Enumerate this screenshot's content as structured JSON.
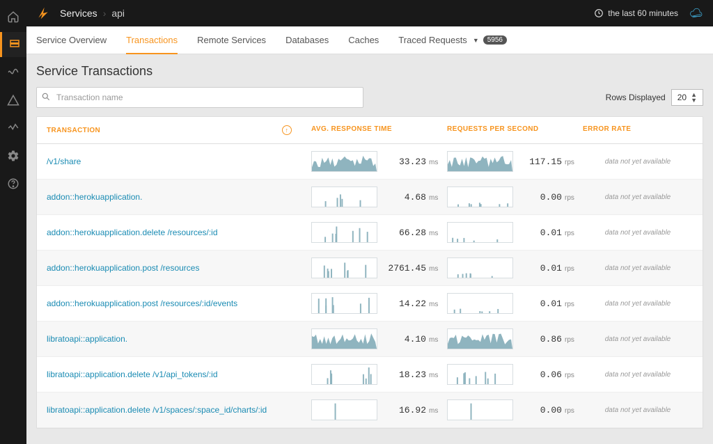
{
  "breadcrumb": {
    "root": "Services",
    "current": "api"
  },
  "time_range": "the last 60 minutes",
  "tabs": [
    {
      "label": "Service Overview"
    },
    {
      "label": "Transactions"
    },
    {
      "label": "Remote Services"
    },
    {
      "label": "Databases"
    },
    {
      "label": "Caches"
    },
    {
      "label": "Traced Requests",
      "badge": "5956"
    }
  ],
  "page_title": "Service Transactions",
  "search": {
    "placeholder": "Transaction name"
  },
  "rows_displayed": {
    "label": "Rows Displayed",
    "value": "20"
  },
  "columns": [
    "Transaction",
    "Avg. Response Time",
    "Requests Per Second",
    "Error Rate"
  ],
  "na_text": "data not yet available",
  "spark_fill": "#8fb4bf",
  "transactions": [
    {
      "name": "/v1/share",
      "rt": "33.23",
      "rt_unit": "ms",
      "rps": "117.15",
      "rps_unit": "rps",
      "rt_spark": "dense",
      "rps_spark": "dense"
    },
    {
      "name": "addon::herokuapplication.",
      "rt": "4.68",
      "rt_unit": "ms",
      "rps": "0.00",
      "rps_unit": "rps",
      "rt_spark": "spikes",
      "rps_spark": "tiny"
    },
    {
      "name": "addon::herokuapplication.delete /resources/:id",
      "rt": "66.28",
      "rt_unit": "ms",
      "rps": "0.01",
      "rps_unit": "rps",
      "rt_spark": "spikes",
      "rps_spark": "tiny"
    },
    {
      "name": "addon::herokuapplication.post /resources",
      "rt": "2761.45",
      "rt_unit": "ms",
      "rps": "0.01",
      "rps_unit": "rps",
      "rt_spark": "spikes",
      "rps_spark": "tiny"
    },
    {
      "name": "addon::herokuapplication.post /resources/:id/events",
      "rt": "14.22",
      "rt_unit": "ms",
      "rps": "0.01",
      "rps_unit": "rps",
      "rt_spark": "spikes",
      "rps_spark": "tiny"
    },
    {
      "name": "libratoapi::application.",
      "rt": "4.10",
      "rt_unit": "ms",
      "rps": "0.86",
      "rps_unit": "rps",
      "rt_spark": "dense",
      "rps_spark": "dense"
    },
    {
      "name": "libratoapi::application.delete /v1/api_tokens/:id",
      "rt": "18.23",
      "rt_unit": "ms",
      "rps": "0.06",
      "rps_unit": "rps",
      "rt_spark": "spikes",
      "rps_spark": "spikes"
    },
    {
      "name": "libratoapi::application.delete /v1/spaces/:space_id/charts/:id",
      "rt": "16.92",
      "rt_unit": "ms",
      "rps": "0.00",
      "rps_unit": "rps",
      "rt_spark": "single",
      "rps_spark": "single"
    }
  ]
}
